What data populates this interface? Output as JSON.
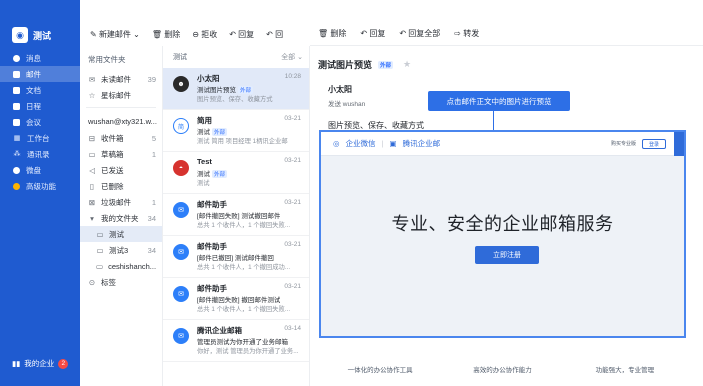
{
  "nav": {
    "brand": "测试",
    "items": [
      {
        "label": "消息",
        "icon": "chat-icon"
      },
      {
        "label": "邮件",
        "icon": "mail-icon",
        "active": true
      },
      {
        "label": "文档",
        "icon": "document-icon"
      },
      {
        "label": "日程",
        "icon": "calendar-icon"
      },
      {
        "label": "会议",
        "icon": "meeting-icon"
      },
      {
        "label": "工作台",
        "icon": "workbench-icon"
      },
      {
        "label": "通讯录",
        "icon": "contacts-icon"
      },
      {
        "label": "微盘",
        "icon": "drive-icon"
      },
      {
        "label": "高级功能",
        "icon": "premium-icon"
      }
    ],
    "footer_label": "我的企业",
    "footer_badge": "2"
  },
  "toolbar": {
    "new_mail": "新建邮件",
    "delete": "删除",
    "reject": "拒收",
    "reply": "回复",
    "more": "回"
  },
  "folders": {
    "header": "常用文件夹",
    "common": [
      {
        "label": "未读邮件",
        "count": "39",
        "icon": "mail-icon"
      },
      {
        "label": "星标邮件",
        "count": "",
        "icon": "star-icon"
      }
    ],
    "account": "wushan@xty321.w...",
    "items": [
      {
        "label": "收件箱",
        "count": "5",
        "icon": "inbox-icon"
      },
      {
        "label": "草稿箱",
        "count": "1",
        "icon": "draft-icon"
      },
      {
        "label": "已发送",
        "count": "",
        "icon": "send-icon"
      },
      {
        "label": "已删除",
        "count": "",
        "icon": "trash-icon"
      },
      {
        "label": "垃圾邮件",
        "count": "1",
        "icon": "spam-icon"
      }
    ],
    "my_folders": {
      "label": "我的文件夹",
      "count": "34"
    },
    "sub": [
      {
        "label": "测试",
        "count": "",
        "active": true
      },
      {
        "label": "测试3",
        "count": "34"
      },
      {
        "label": "ceshishanch...",
        "count": ""
      }
    ],
    "tags": "标签"
  },
  "list": {
    "header": "测试",
    "sort": "全部",
    "messages": [
      {
        "sender": "小太阳",
        "time": "10:28",
        "subject": "测试图片预览",
        "tag": "外部",
        "preview": "图片预览、保存、收藏方式",
        "avatar": "dark",
        "selected": true
      },
      {
        "sender": "简用",
        "time": "03-21",
        "subject": "测试",
        "tag": "外部",
        "preview": "测试 简用 项目经理 1柄讯企业邮",
        "avatar": "ring",
        "initial": "简"
      },
      {
        "sender": "Test",
        "time": "03-21",
        "subject": "测试",
        "tag": "外部",
        "preview": "测试",
        "avatar": "red"
      },
      {
        "sender": "邮件助手",
        "time": "03-21",
        "subject": "[邮件撤回失败] 测试撤回邮件",
        "tag": "",
        "preview": "总共 1 个收件人，1 个撤回失败...",
        "avatar": "blue"
      },
      {
        "sender": "邮件助手",
        "time": "03-21",
        "subject": "[邮件已撤回] 测试邮件撤回",
        "tag": "",
        "preview": "总共 1 个收件人，1 个撤回成功...",
        "avatar": "blue"
      },
      {
        "sender": "邮件助手",
        "time": "03-21",
        "subject": "[邮件撤回失败] 撤回邮件测试",
        "tag": "",
        "preview": "总共 1 个收件人，1 个撤回失败...",
        "avatar": "blue"
      },
      {
        "sender": "腾讯企业邮箱",
        "time": "03-14",
        "subject": "管理员测试为你开通了业务邮箱",
        "tag": "",
        "preview": "你好，测试 管理员为你开通了业务...",
        "avatar": "blue"
      }
    ]
  },
  "reader": {
    "toolbar": {
      "delete": "删除",
      "reply": "回复",
      "reply_all": "回复全部",
      "forward": "转发"
    },
    "title": "测试图片预览",
    "title_tag": "外部",
    "from_name": "小太阳",
    "from_addr": "发送 wushan",
    "tooltip": "点击邮件正文中的图片进行预览",
    "intro": "图片预览、保存、收藏方式"
  },
  "preview": {
    "brand1": "企业微信",
    "brand2": "腾讯企业邮",
    "top_link": "购买专业版",
    "top_btn": "登录",
    "headline": "专业、安全的企业邮箱服务",
    "cta": "立即注册",
    "features": [
      "一体化的办公协作工具",
      "高效的办公协作能力",
      "功能强大，专业管理"
    ]
  },
  "colors": {
    "nav_bg": "#1f5bd0",
    "accent": "#2f6bd9",
    "selected_row": "#e1e9f8"
  }
}
